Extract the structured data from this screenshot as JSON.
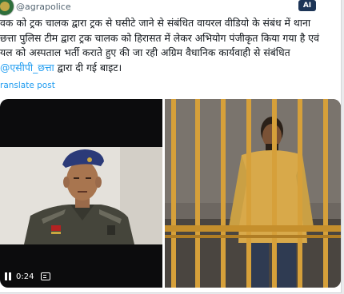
{
  "post": {
    "author_handle": "@agrapolice",
    "ai_badge": "AI",
    "text_lines": [
      "वक को ट्रक चालक द्वारा ट्रक से घसीटे जाने से संबंधित वायरल वीडियो के संबंध में थाना",
      "छत्ता पुलिस टीम द्वारा ट्रक चालक को हिरासत में लेकर अभियोग पंजीकृत किया गया है एवं",
      "यल को अस्पताल भर्ती कराते हुए की जा रही अग्रिम वैधानिक कार्यवाही से संबंधित"
    ],
    "mention": "@एसीपी_छत्ता",
    "line4_rest": " द्वारा दी गई बाइट।",
    "translate_label": "ranslate post"
  },
  "video": {
    "time": "0:24",
    "controls": [
      "pause-icon",
      "captions-icon"
    ]
  },
  "colors": {
    "link": "#1d9bf0",
    "text": "#0f1419",
    "beret": "#2b3a78",
    "uniform": "#3f3f37",
    "bars": "#d6a03a"
  }
}
